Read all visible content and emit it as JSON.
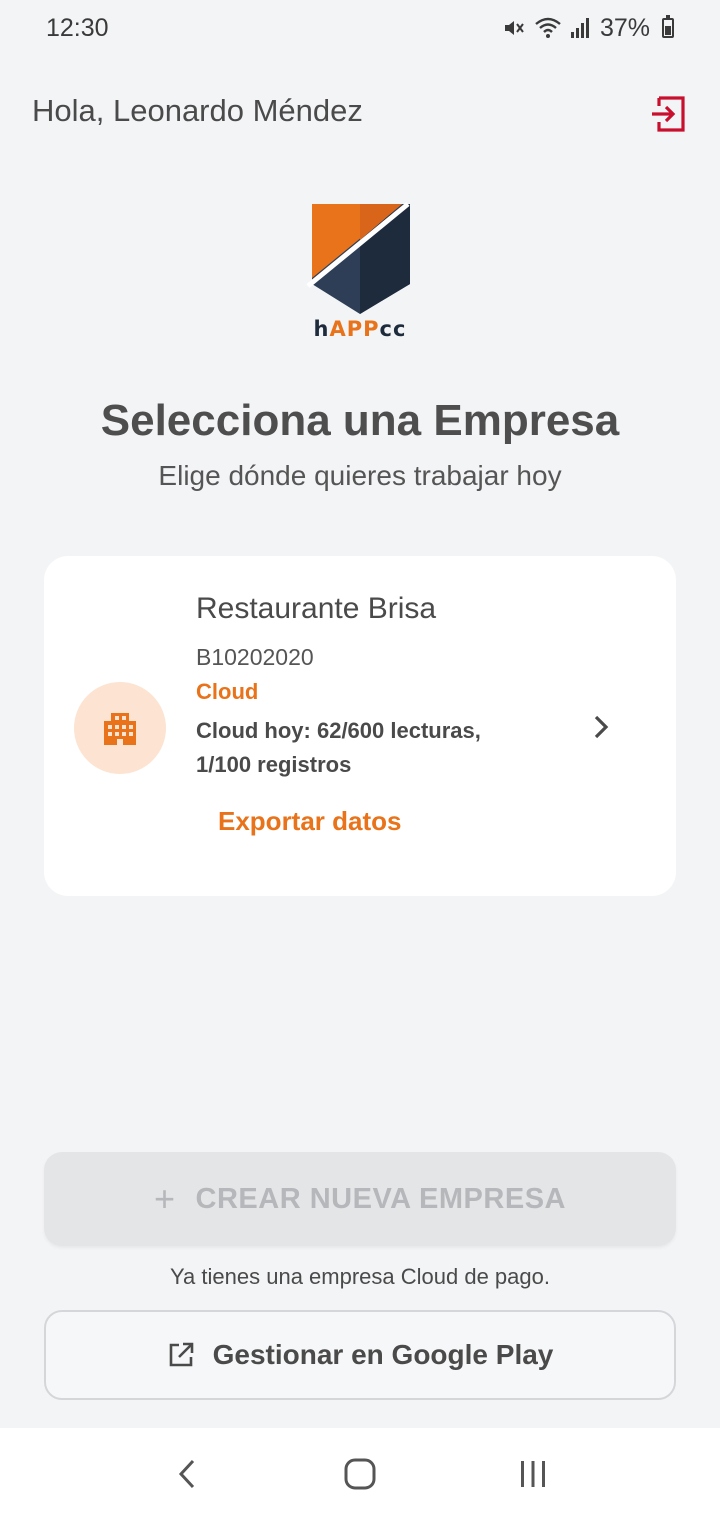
{
  "status_bar": {
    "time": "12:30",
    "battery": "37%",
    "icons": [
      "mute-icon",
      "wifi-icon",
      "signal-icon",
      "battery-icon"
    ]
  },
  "header": {
    "greeting": "Hola, Leonardo Méndez",
    "logout_icon": "logout-icon"
  },
  "brand": {
    "logo_h": "h",
    "logo_app": "APP",
    "logo_cc": "cc",
    "colors": {
      "orange": "#e8731a",
      "navy": "#1e2b3d",
      "accent_red": "#c8102e"
    }
  },
  "main": {
    "title": "Selecciona una Empresa",
    "subtitle": "Elige dónde quieres trabajar hoy"
  },
  "company": {
    "name": "Restaurante Brisa",
    "id": "B10202020",
    "plan": "Cloud",
    "usage_line1": "Cloud hoy: 62/600 lecturas,",
    "usage_line2": "1/100 registros",
    "export_label": "Exportar datos",
    "icon": "building-icon"
  },
  "actions": {
    "create_label": "CREAR NUEVA EMPRESA",
    "create_icon": "plus-icon",
    "note": "Ya tienes una empresa Cloud de pago.",
    "play_label": "Gestionar en Google Play",
    "play_icon": "external-link-icon"
  },
  "nav": {
    "back": "back-icon",
    "home": "home-icon",
    "recents": "recents-icon"
  }
}
